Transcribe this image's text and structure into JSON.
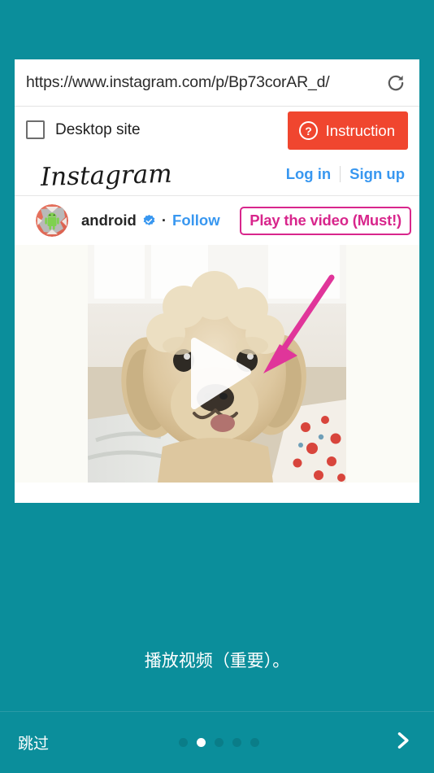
{
  "theme": {
    "background": "#0b8e9b",
    "accent_red": "#f0462f",
    "annotation_pink": "#d8268c",
    "link_blue": "#3897f0",
    "dot_inactive": "#0a7d88"
  },
  "browser": {
    "url": "https://www.instagram.com/p/Bp73corAR_d/",
    "reload_icon": "reload-icon",
    "desktop_site": {
      "label": "Desktop site",
      "checked": false
    },
    "instruction_button": {
      "label": "Instruction",
      "icon": "help-circle-icon"
    }
  },
  "instagram": {
    "logo_text": "Instagram",
    "auth": {
      "login_label": "Log in",
      "separator": "|",
      "signup_label": "Sign up"
    },
    "post": {
      "avatar_icon": "android-avatar-icon",
      "username": "android",
      "verified_icon": "verified-badge-icon",
      "separator": "·",
      "follow_label": "Follow",
      "media_type": "video",
      "play_icon": "play-triangle-icon"
    }
  },
  "annotation": {
    "callout_label": "Play the video (Must!)",
    "arrow_icon": "arrow-pointing-down-left-icon"
  },
  "tutorial": {
    "caption": "播放视频（重要）。",
    "skip_label": "跳过",
    "next_icon": "chevron-right-icon",
    "page_count": 5,
    "current_page": 2
  }
}
